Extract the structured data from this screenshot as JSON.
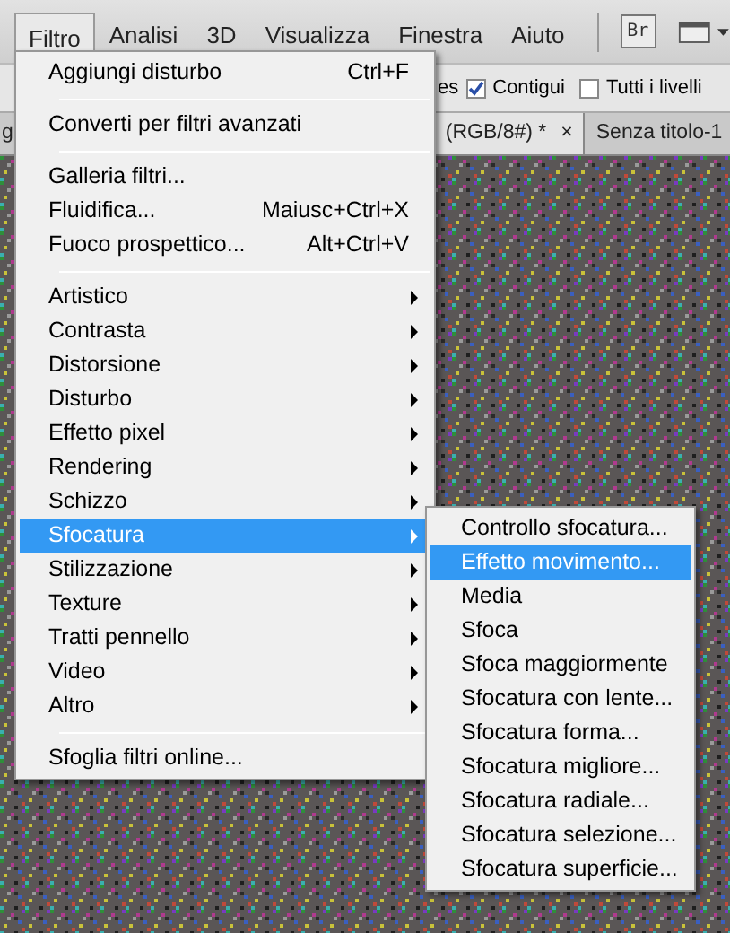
{
  "menubar": {
    "items": [
      {
        "label": "Filtro",
        "selected": true
      },
      {
        "label": "Analisi",
        "selected": false
      },
      {
        "label": "3D",
        "selected": false
      },
      {
        "label": "Visualizza",
        "selected": false
      },
      {
        "label": "Finestra",
        "selected": false
      },
      {
        "label": "Aiuto",
        "selected": false
      }
    ],
    "bridge_label": "Br"
  },
  "options_bar": {
    "text_fragment": "es",
    "checkboxes": [
      {
        "label": "Contigui",
        "checked": true
      },
      {
        "label": "Tutti i livelli",
        "checked": false
      }
    ]
  },
  "document_tabs": [
    {
      "label": "g",
      "selected": false
    },
    {
      "label": "(RGB/8#) *",
      "close": "×",
      "selected": true
    },
    {
      "label": "Senza titolo-1",
      "selected": false
    }
  ],
  "menu": {
    "items": [
      {
        "kind": "item",
        "label": "Aggiungi disturbo",
        "shortcut": "Ctrl+F",
        "selected": false
      },
      {
        "kind": "separator"
      },
      {
        "kind": "item",
        "label": "Converti per filtri avanzati",
        "selected": false
      },
      {
        "kind": "separator"
      },
      {
        "kind": "item",
        "label": "Galleria filtri...",
        "selected": false
      },
      {
        "kind": "item",
        "label": "Fluidifica...",
        "shortcut": "Maiusc+Ctrl+X",
        "selected": false
      },
      {
        "kind": "item",
        "label": "Fuoco prospettico...",
        "shortcut": "Alt+Ctrl+V",
        "selected": false
      },
      {
        "kind": "separator"
      },
      {
        "kind": "submenu",
        "label": "Artistico",
        "selected": false
      },
      {
        "kind": "submenu",
        "label": "Contrasta",
        "selected": false
      },
      {
        "kind": "submenu",
        "label": "Distorsione",
        "selected": false
      },
      {
        "kind": "submenu",
        "label": "Disturbo",
        "selected": false
      },
      {
        "kind": "submenu",
        "label": "Effetto pixel",
        "selected": false
      },
      {
        "kind": "submenu",
        "label": "Rendering",
        "selected": false
      },
      {
        "kind": "submenu",
        "label": "Schizzo",
        "selected": false
      },
      {
        "kind": "submenu",
        "label": "Sfocatura",
        "selected": true
      },
      {
        "kind": "submenu",
        "label": "Stilizzazione",
        "selected": false
      },
      {
        "kind": "submenu",
        "label": "Texture",
        "selected": false
      },
      {
        "kind": "submenu",
        "label": "Tratti pennello",
        "selected": false
      },
      {
        "kind": "submenu",
        "label": "Video",
        "selected": false
      },
      {
        "kind": "submenu",
        "label": "Altro",
        "selected": false
      },
      {
        "kind": "separator"
      },
      {
        "kind": "item",
        "label": "Sfoglia filtri online...",
        "selected": false
      }
    ]
  },
  "submenu": {
    "items": [
      {
        "label": "Controllo sfocatura...",
        "selected": false
      },
      {
        "label": "Effetto movimento...",
        "selected": true
      },
      {
        "label": "Media",
        "selected": false
      },
      {
        "label": "Sfoca",
        "selected": false
      },
      {
        "label": "Sfoca maggiormente",
        "selected": false
      },
      {
        "label": "Sfocatura con lente...",
        "selected": false
      },
      {
        "label": "Sfocatura forma...",
        "selected": false
      },
      {
        "label": "Sfocatura migliore...",
        "selected": false
      },
      {
        "label": "Sfocatura radiale...",
        "selected": false
      },
      {
        "label": "Sfocatura selezione...",
        "selected": false
      },
      {
        "label": "Sfocatura superficie...",
        "selected": false
      }
    ]
  }
}
